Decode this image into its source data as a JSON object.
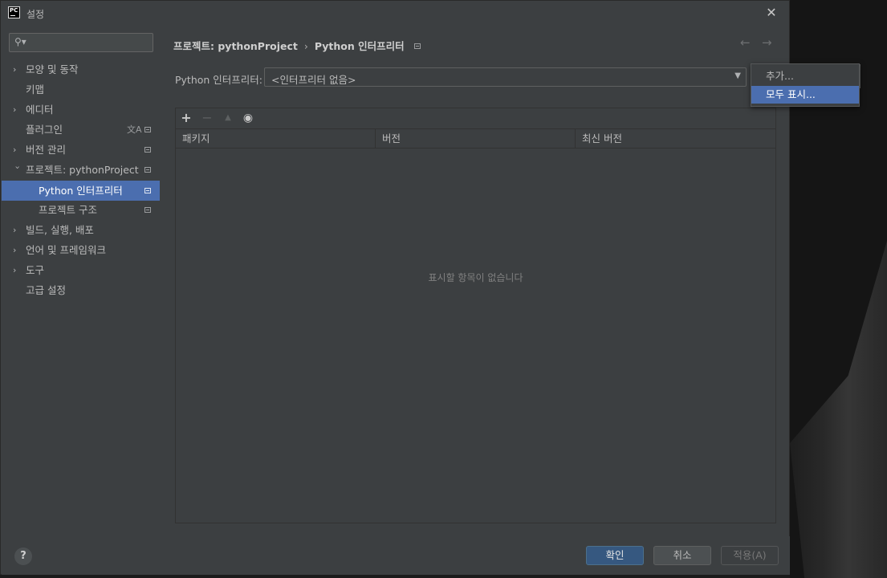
{
  "window": {
    "title": "설정",
    "logo_text": "PC",
    "close_glyph": "✕"
  },
  "sidebar": {
    "search_placeholder": "",
    "items": [
      {
        "label": "모양 및 동작",
        "expandable": true
      },
      {
        "label": "키맵",
        "expandable": false
      },
      {
        "label": "에디터",
        "expandable": true
      },
      {
        "label": "플러그인",
        "expandable": false
      },
      {
        "label": "버전 관리",
        "expandable": true
      },
      {
        "label": "프로젝트: pythonProject",
        "expandable": true,
        "expanded": true
      },
      {
        "label": "Python 인터프리터",
        "selected": true
      },
      {
        "label": "프로젝트 구조"
      },
      {
        "label": "빌드, 실행, 배포",
        "expandable": true
      },
      {
        "label": "언어 및 프레임워크",
        "expandable": true
      },
      {
        "label": "도구",
        "expandable": true
      },
      {
        "label": "고급 설정",
        "expandable": false
      }
    ]
  },
  "breadcrumb": {
    "parent": "프로젝트: pythonProject",
    "current": "Python 인터프리터"
  },
  "interpreter": {
    "label": "Python 인터프리터:",
    "value": "<인터프리터 없음>"
  },
  "packages": {
    "columns": [
      "패키지",
      "버전",
      "최신 버전"
    ],
    "rows": [],
    "empty_text": "표시할 항목이 없습니다"
  },
  "popup_menu": {
    "items": [
      "추가...",
      "모두 표시..."
    ],
    "highlighted_index": 1
  },
  "footer": {
    "help": "?",
    "ok": "확인",
    "cancel": "취소",
    "apply": "적용(A)"
  },
  "colors": {
    "background": "#3c3f41",
    "selection": "#4b6eaf",
    "ok_button": "#365880",
    "text": "#bbbbbb"
  },
  "icons": {
    "search": "search-icon",
    "expand_arrow": "chevron-right-icon",
    "collapse_arrow": "chevron-down-icon",
    "project_scope": "project-scope-icon",
    "translate": "translate-icon",
    "add": "plus-icon",
    "remove": "minus-icon",
    "upgrade": "upgrade-icon",
    "show_early": "eye-icon",
    "back": "back-arrow-icon",
    "forward": "forward-arrow-icon"
  }
}
